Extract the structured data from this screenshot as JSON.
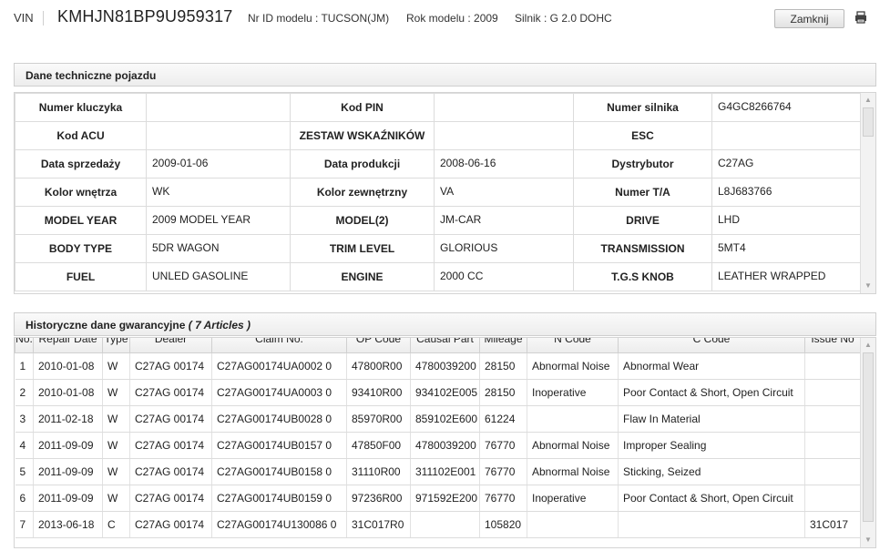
{
  "header": {
    "vin_label": "VIN",
    "vin_value": "KMHJN81BP9U959317",
    "model_id": "Nr ID modelu : TUCSON(JM)",
    "model_year": "Rok modelu : 2009",
    "engine": "Silnik : G 2.0 DOHC",
    "close_label": "Zamknij"
  },
  "tech": {
    "title": "Dane techniczne pojazdu",
    "rows": [
      [
        {
          "l": "Numer kluczyka",
          "v": ""
        },
        {
          "l": "Kod PIN",
          "v": ""
        },
        {
          "l": "Numer silnika",
          "v": "G4GC8266764"
        }
      ],
      [
        {
          "l": "Kod ACU",
          "v": ""
        },
        {
          "l": "ZESTAW WSKAŹNIKÓW",
          "v": ""
        },
        {
          "l": "ESC",
          "v": ""
        }
      ],
      [
        {
          "l": "Data sprzedaży",
          "v": "2009-01-06"
        },
        {
          "l": "Data produkcji",
          "v": "2008-06-16"
        },
        {
          "l": "Dystrybutor",
          "v": "C27AG"
        }
      ],
      [
        {
          "l": "Kolor wnętrza",
          "v": "WK"
        },
        {
          "l": "Kolor zewnętrzny",
          "v": "VA"
        },
        {
          "l": "Numer T/A",
          "v": "L8J683766"
        }
      ],
      [
        {
          "l": "MODEL YEAR",
          "v": "2009 MODEL YEAR"
        },
        {
          "l": "MODEL(2)",
          "v": "JM-CAR"
        },
        {
          "l": "DRIVE",
          "v": "LHD"
        }
      ],
      [
        {
          "l": "BODY TYPE",
          "v": "5DR WAGON"
        },
        {
          "l": "TRIM LEVEL",
          "v": "GLORIOUS"
        },
        {
          "l": "TRANSMISSION",
          "v": "5MT4"
        }
      ],
      [
        {
          "l": "FUEL",
          "v": "UNLED GASOLINE"
        },
        {
          "l": "ENGINE",
          "v": "2000 CC"
        },
        {
          "l": "T.G.S KNOB",
          "v": "LEATHER WRAPPED"
        }
      ]
    ]
  },
  "warranty": {
    "title": "Historyczne dane gwarancyjne",
    "count": "( 7 Articles )",
    "columns": [
      "No.",
      "Repair Date",
      "Type",
      "Dealer",
      "Claim No.",
      "OP Code",
      "Causal Part",
      "Mileage",
      "N Code",
      "C Code",
      "Issue No"
    ],
    "rows": [
      [
        "1",
        "2010-01-08",
        "W",
        "C27AG 00174",
        "C27AG00174UA0002 0",
        "47800R00",
        "4780039200",
        "28150",
        "Abnormal Noise",
        "Abnormal Wear",
        ""
      ],
      [
        "2",
        "2010-01-08",
        "W",
        "C27AG 00174",
        "C27AG00174UA0003 0",
        "93410R00",
        "934102E005",
        "28150",
        "Inoperative",
        "Poor Contact & Short, Open Circuit",
        ""
      ],
      [
        "3",
        "2011-02-18",
        "W",
        "C27AG 00174",
        "C27AG00174UB0028 0",
        "85970R00",
        "859102E600",
        "61224",
        "",
        "Flaw In Material",
        ""
      ],
      [
        "4",
        "2011-09-09",
        "W",
        "C27AG 00174",
        "C27AG00174UB0157 0",
        "47850F00",
        "4780039200",
        "76770",
        "Abnormal Noise",
        "Improper Sealing",
        ""
      ],
      [
        "5",
        "2011-09-09",
        "W",
        "C27AG 00174",
        "C27AG00174UB0158 0",
        "31110R00",
        "311102E001",
        "76770",
        "Abnormal Noise",
        "Sticking, Seized",
        ""
      ],
      [
        "6",
        "2011-09-09",
        "W",
        "C27AG 00174",
        "C27AG00174UB0159 0",
        "97236R00",
        "971592E200",
        "76770",
        "Inoperative",
        "Poor Contact & Short, Open Circuit",
        ""
      ],
      [
        "7",
        "2013-06-18",
        "C",
        "C27AG 00174",
        "C27AG00174U130086 0",
        "31C017R0",
        "",
        "105820",
        "",
        "",
        "31C017"
      ]
    ]
  }
}
